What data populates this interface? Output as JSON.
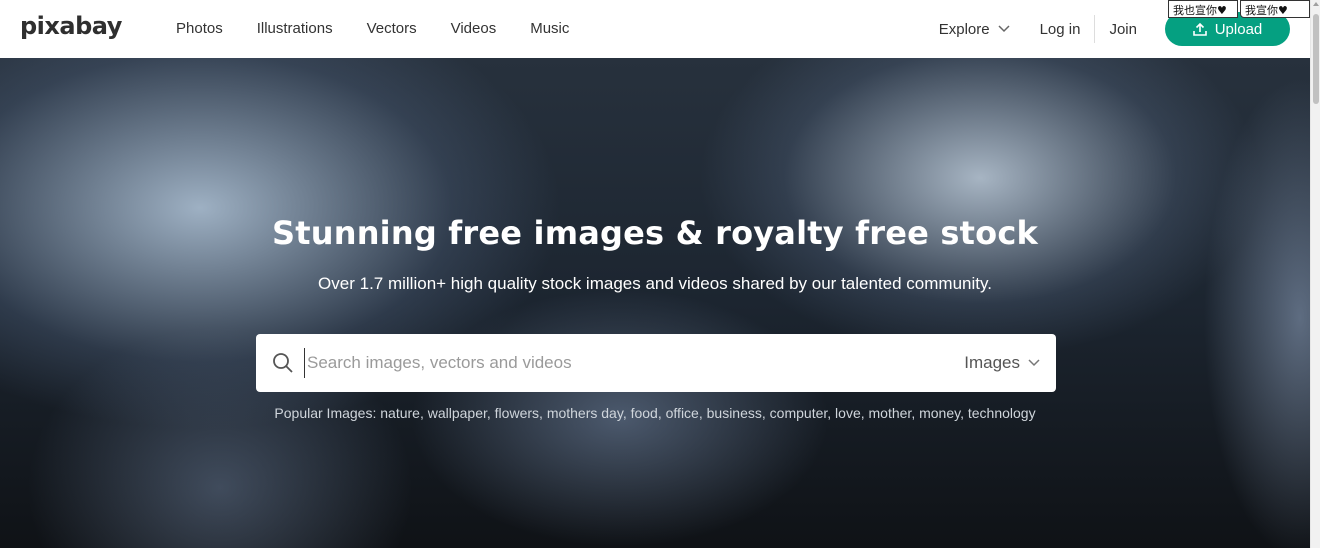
{
  "header": {
    "logo": "pixabay",
    "nav": [
      "Photos",
      "Illustrations",
      "Vectors",
      "Videos",
      "Music"
    ],
    "explore_label": "Explore",
    "login_label": "Log in",
    "join_label": "Join",
    "upload_label": "Upload",
    "accent_color": "#05a081"
  },
  "stickers": [
    "我也宣你♥",
    "我宣你♥"
  ],
  "hero": {
    "title": "Stunning free images & royalty free stock",
    "subtitle": "Over 1.7 million+ high quality stock images and videos shared by our talented community.",
    "search": {
      "placeholder": "Search images, vectors and videos",
      "value": "",
      "type_selected": "Images"
    },
    "popular_label": "Popular Images:",
    "popular_tags": [
      "nature",
      "wallpaper",
      "flowers",
      "mothers day",
      "food",
      "office",
      "business",
      "computer",
      "love",
      "mother",
      "money",
      "technology"
    ]
  }
}
